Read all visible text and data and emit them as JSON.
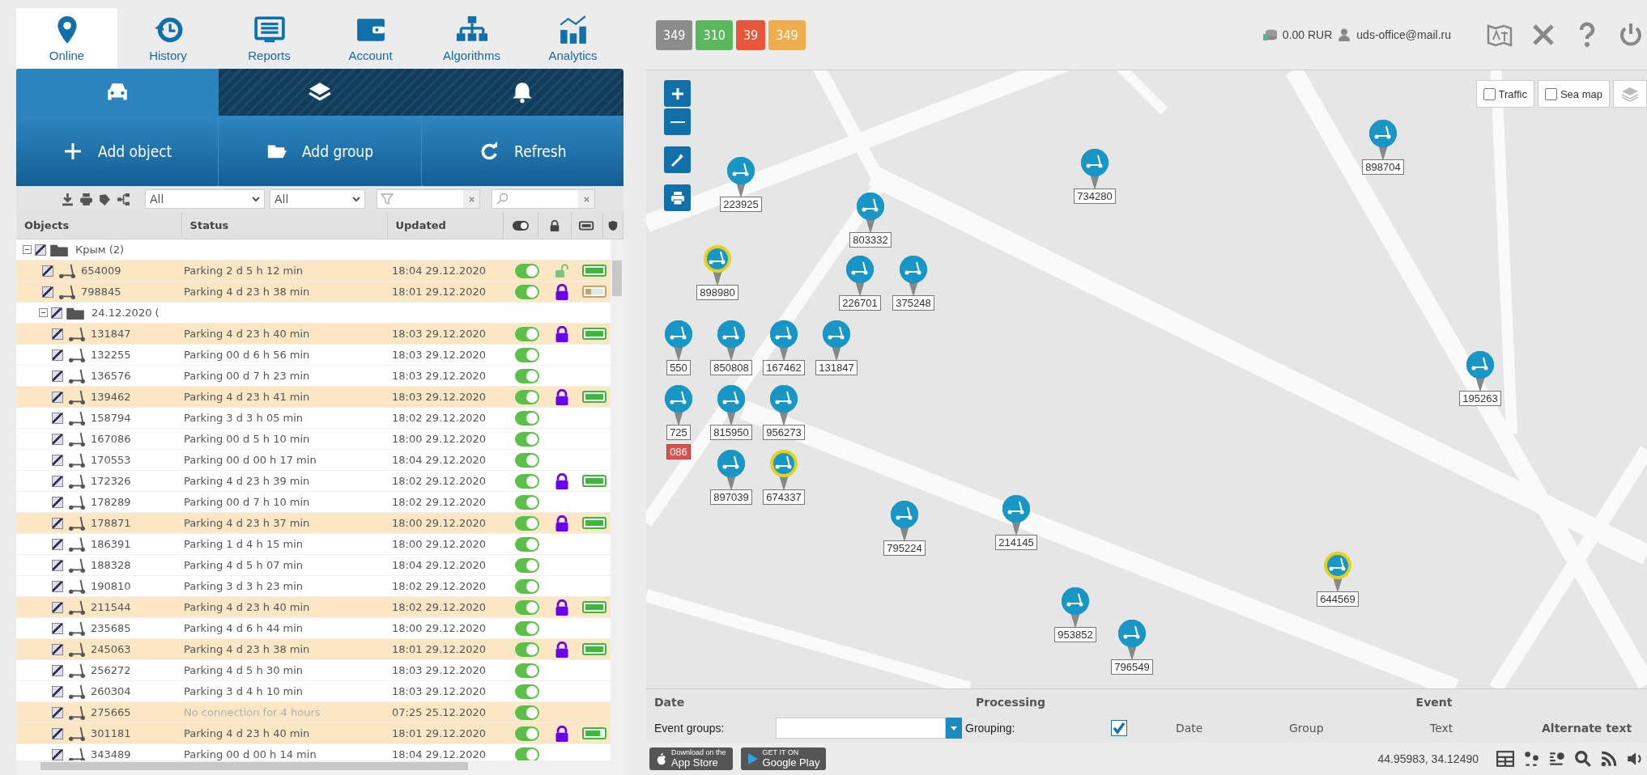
{
  "nav": [
    {
      "label": "Online",
      "selected": true
    },
    {
      "label": "History",
      "selected": false
    },
    {
      "label": "Reports",
      "selected": false
    },
    {
      "label": "Account",
      "selected": false
    },
    {
      "label": "Algorithms",
      "selected": false
    },
    {
      "label": "Analytics",
      "selected": false
    }
  ],
  "panel_tabs": [
    {
      "selected": true
    },
    {
      "selected": false
    },
    {
      "selected": false
    }
  ],
  "actions": [
    {
      "label": "Add object"
    },
    {
      "label": "Add group"
    },
    {
      "label": "Refresh"
    }
  ],
  "filters": {
    "select_1": "All",
    "select_2": "All"
  },
  "table": {
    "columns": [
      "Objects",
      "Status",
      "Updated"
    ],
    "groups": [
      {
        "name": "Крым (2)",
        "expanded": true,
        "checked": true,
        "children": [
          {
            "name": "654009",
            "status": "Parking 2 d 5 h 12 min",
            "updated": "18:04 29.12.2020",
            "highlighted": true,
            "checked": true,
            "offline": false,
            "on": true,
            "locked": false,
            "level": 1
          },
          {
            "name": "798845",
            "status": "Parking 4 d 23 h 38 min",
            "updated": "18:01 29.12.2020",
            "highlighted": true,
            "checked": true,
            "offline": false,
            "on": true,
            "locked": true,
            "level": 0.3
          }
        ]
      },
      {
        "name": "24.12.2020 (",
        "expanded": true,
        "checked": true,
        "children": [
          {
            "name": "131847",
            "status": "Parking 4 d 23 h 40 min",
            "updated": "18:03 29.12.2020",
            "highlighted": true,
            "checked": true,
            "offline": false,
            "on": true,
            "locked": true,
            "level": 1
          },
          {
            "name": "132255",
            "status": "Parking 00 d 6 h 56 min",
            "updated": "18:03 29.12.2020",
            "highlighted": false,
            "checked": true,
            "offline": false,
            "on": true
          },
          {
            "name": "136576",
            "status": "Parking 00 d 7 h 23 min",
            "updated": "18:03 29.12.2020",
            "highlighted": false,
            "checked": true,
            "offline": false,
            "on": true
          },
          {
            "name": "139462",
            "status": "Parking 4 d 23 h 41 min",
            "updated": "18:03 29.12.2020",
            "highlighted": true,
            "checked": true,
            "offline": false,
            "on": true,
            "locked": true,
            "level": 1
          },
          {
            "name": "158794",
            "status": "Parking 3 d 3 h 05 min",
            "updated": "18:02 29.12.2020",
            "highlighted": false,
            "checked": true,
            "offline": false,
            "on": true
          },
          {
            "name": "167086",
            "status": "Parking 00 d 5 h 10 min",
            "updated": "18:00 29.12.2020",
            "highlighted": false,
            "checked": true,
            "offline": false,
            "on": true
          },
          {
            "name": "170553",
            "status": "Parking 00 d 00 h 17 min",
            "updated": "18:04 29.12.2020",
            "highlighted": false,
            "checked": true,
            "offline": false,
            "on": true
          },
          {
            "name": "172326",
            "status": "Parking 4 d 23 h 39 min",
            "updated": "18:02 29.12.2020",
            "highlighted": false,
            "checked": true,
            "offline": false,
            "on": true,
            "locked": true,
            "level": 1
          },
          {
            "name": "178289",
            "status": "Parking 00 d 7 h 10 min",
            "updated": "18:02 29.12.2020",
            "highlighted": false,
            "checked": true,
            "offline": false,
            "on": true
          },
          {
            "name": "178871",
            "status": "Parking 4 d 23 h 37 min",
            "updated": "18:00 29.12.2020",
            "highlighted": true,
            "checked": true,
            "offline": false,
            "on": true,
            "locked": true,
            "level": 1
          },
          {
            "name": "186391",
            "status": "Parking 1 d 4 h 15 min",
            "updated": "18:00 29.12.2020",
            "highlighted": false,
            "checked": true,
            "offline": false,
            "on": true
          },
          {
            "name": "188328",
            "status": "Parking 4 d 5 h 07 min",
            "updated": "18:04 29.12.2020",
            "highlighted": false,
            "checked": true,
            "offline": false,
            "on": true
          },
          {
            "name": "190810",
            "status": "Parking 3 d 3 h 23 min",
            "updated": "18:02 29.12.2020",
            "highlighted": false,
            "checked": true,
            "offline": false,
            "on": true
          },
          {
            "name": "211544",
            "status": "Parking 4 d 23 h 40 min",
            "updated": "18:02 29.12.2020",
            "highlighted": true,
            "checked": true,
            "offline": false,
            "on": true,
            "locked": true,
            "level": 1
          },
          {
            "name": "235685",
            "status": "Parking 4 d 6 h 44 min",
            "updated": "18:00 29.12.2020",
            "highlighted": false,
            "checked": true,
            "offline": false,
            "on": true
          },
          {
            "name": "245063",
            "status": "Parking 4 d 23 h 38 min",
            "updated": "18:01 29.12.2020",
            "highlighted": true,
            "checked": true,
            "offline": false,
            "on": true,
            "locked": true,
            "level": 1
          },
          {
            "name": "256272",
            "status": "Parking 4 d 5 h 30 min",
            "updated": "18:03 29.12.2020",
            "highlighted": false,
            "checked": true,
            "offline": false,
            "on": true
          },
          {
            "name": "260304",
            "status": "Parking 3 d 4 h 10 min",
            "updated": "18:03 29.12.2020",
            "highlighted": false,
            "checked": true,
            "offline": false,
            "on": true
          },
          {
            "name": "275665",
            "status": "No connection for 4 hours",
            "updated": "07:25 25.12.2020",
            "highlighted": true,
            "checked": true,
            "offline": true,
            "on": true
          },
          {
            "name": "301181",
            "status": "Parking 4 d 23 h 40 min",
            "updated": "18:01 29.12.2020",
            "highlighted": true,
            "checked": true,
            "offline": false,
            "on": true,
            "locked": true,
            "level": 0.8
          },
          {
            "name": "343489",
            "status": "Parking 00 d 00 h 14 min",
            "updated": "18:04 29.12.2020",
            "highlighted": false,
            "checked": true,
            "offline": false,
            "on": true
          }
        ]
      }
    ]
  },
  "counters": [
    {
      "text": "349",
      "color": "#8c8c8c"
    },
    {
      "text": "310",
      "color": "#5cb85c"
    },
    {
      "text": "39",
      "color": "#e9553b"
    },
    {
      "text": "349",
      "color": "#f0ad4e"
    }
  ],
  "balance": "0.00 RUR",
  "user": "uds-office@mail.ru",
  "map": {
    "toggles": [
      {
        "label": "Traffic",
        "checked": false
      },
      {
        "label": "Sea map",
        "checked": false
      }
    ],
    "markers": [
      {
        "label": "223925",
        "highlighted": false
      },
      {
        "label": "734280",
        "highlighted": false
      },
      {
        "label": "898704",
        "highlighted": false
      },
      {
        "label": "803332",
        "highlighted": false
      },
      {
        "label": "898980",
        "highlighted": true
      },
      {
        "label": "226701",
        "highlighted": false
      },
      {
        "label": "375248",
        "highlighted": false
      },
      {
        "label": "850808",
        "highlighted": false
      },
      {
        "label": "167462",
        "highlighted": false
      },
      {
        "label": "131847",
        "highlighted": false
      },
      {
        "label": "815950",
        "highlighted": false
      },
      {
        "label": "956273",
        "highlighted": false
      },
      {
        "label": "897039",
        "highlighted": false
      },
      {
        "label": "674337",
        "highlighted": true
      },
      {
        "label": "195263",
        "highlighted": false
      },
      {
        "label": "795224",
        "highlighted": false
      },
      {
        "label": "214145",
        "highlighted": false
      },
      {
        "label": "644569",
        "highlighted": true
      },
      {
        "label": "953852",
        "highlighted": false
      },
      {
        "label": "796549",
        "highlighted": false
      },
      {
        "label": "550",
        "highlighted": false
      },
      {
        "label": "725",
        "highlighted": false
      },
      {
        "label": "086",
        "alert": true
      }
    ]
  },
  "events": {
    "headers_top": [
      "Date",
      "Processing",
      "Event"
    ],
    "headers": [
      "Date",
      "Group",
      "Text",
      "Alternate text"
    ],
    "groups_label": "Event groups:",
    "grouping_label": "Grouping:",
    "grouping": true
  },
  "footer": {
    "app_store": {
      "small": "Download on the",
      "big": "App Store"
    },
    "google_play": {
      "small": "GET IT ON",
      "big": "Google Play"
    },
    "coords": "44.95983, 34.12490"
  }
}
